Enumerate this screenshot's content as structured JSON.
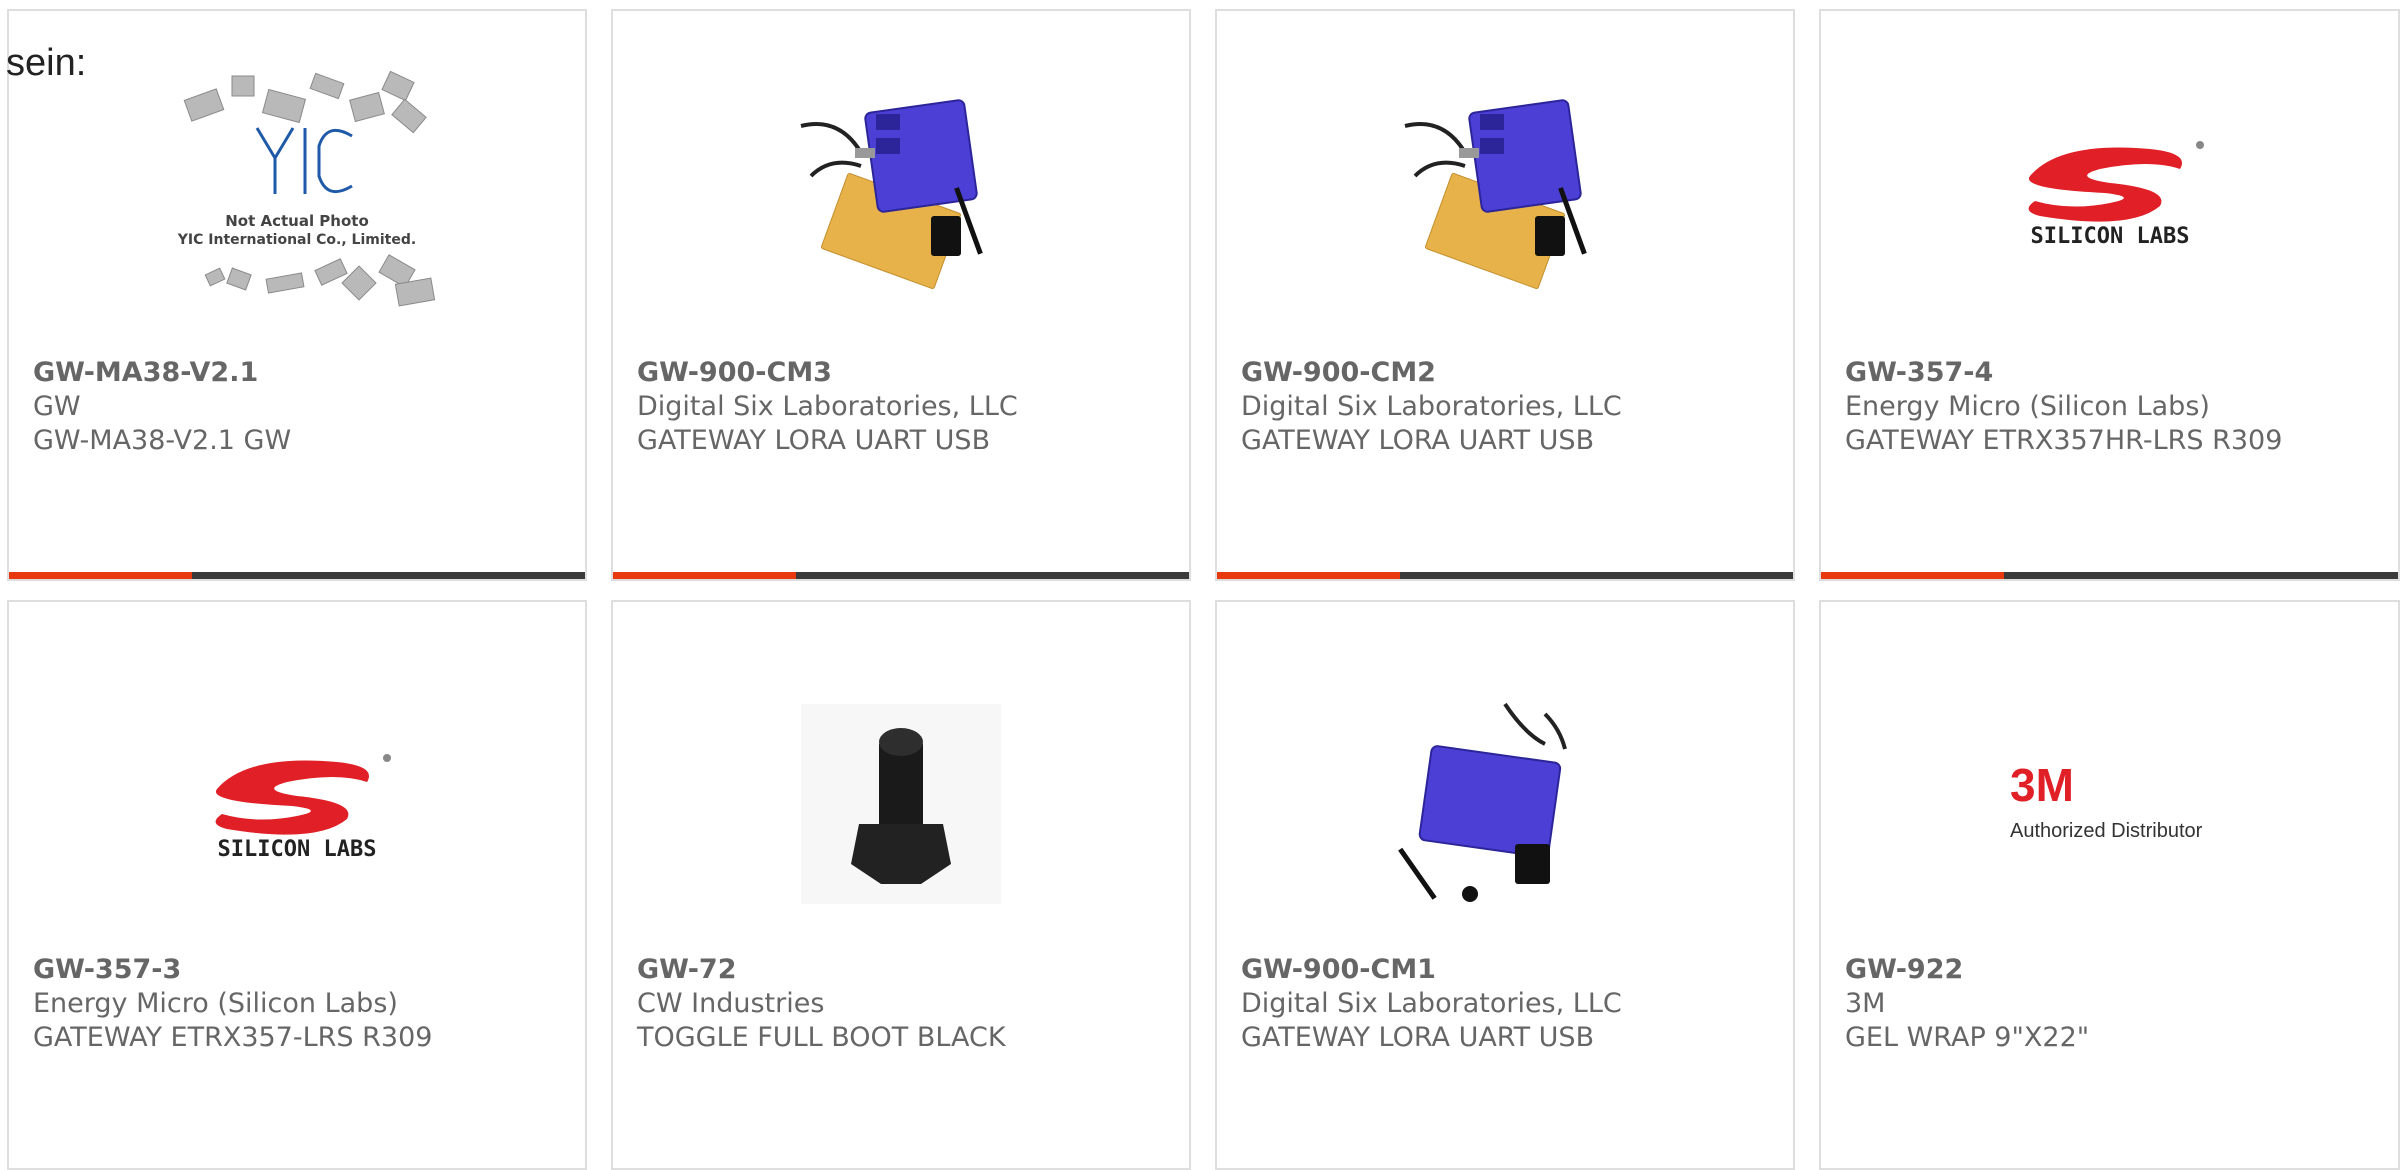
{
  "heading": "sein:",
  "products": [
    {
      "part_number": "GW-MA38-V2.1",
      "manufacturer": "GW",
      "description": "GW-MA38-V2.1 GW",
      "image": "yic-not-actual-photo",
      "photo_text": {
        "logo": "YIC",
        "line1": "Not Actual Photo",
        "line2": "YIC International Co., Limited."
      }
    },
    {
      "part_number": "GW-900-CM3",
      "manufacturer": "Digital Six Laboratories, LLC",
      "description": "GATEWAY LORA UART USB",
      "image": "gateway-kit-photo"
    },
    {
      "part_number": "GW-900-CM2",
      "manufacturer": "Digital Six Laboratories, LLC",
      "description": "GATEWAY LORA UART USB",
      "image": "gateway-kit-photo"
    },
    {
      "part_number": "GW-357-4",
      "manufacturer": "Energy Micro (Silicon Labs)",
      "description": "GATEWAY ETRX357HR-LRS R309",
      "image": "silicon-labs-logo",
      "photo_text": {
        "logo": "SILICON LABS"
      }
    },
    {
      "part_number": "GW-357-3",
      "manufacturer": "Energy Micro (Silicon Labs)",
      "description": "GATEWAY ETRX357-LRS R309",
      "image": "silicon-labs-logo",
      "photo_text": {
        "logo": "SILICON LABS"
      }
    },
    {
      "part_number": "GW-72",
      "manufacturer": "CW Industries",
      "description": "TOGGLE FULL BOOT BLACK",
      "image": "toggle-boot-photo"
    },
    {
      "part_number": "GW-900-CM1",
      "manufacturer": "Digital Six Laboratories, LLC",
      "description": "GATEWAY LORA UART USB",
      "image": "gateway-kit-photo"
    },
    {
      "part_number": "GW-922",
      "manufacturer": "3M",
      "description": "GEL WRAP 9\"X22\"",
      "image": "3m-authorized-distributor",
      "photo_text": {
        "logo": "3M",
        "line1": "Authorized Distributor"
      }
    }
  ],
  "colors": {
    "accent_red": "#e8380d",
    "bar_dark": "#3a3a3a",
    "border": "#dedede",
    "text": "#666666",
    "silabs_red": "#e01f26",
    "device_blue": "#4b3fd6"
  }
}
